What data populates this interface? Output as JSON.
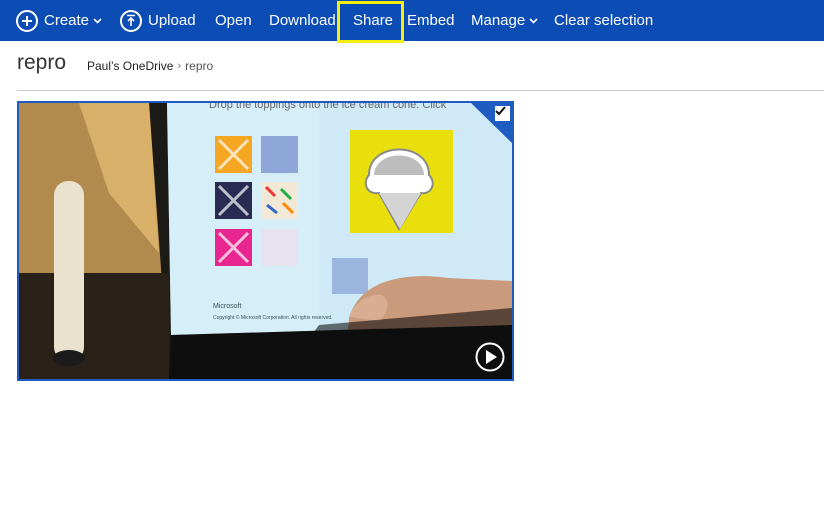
{
  "toolbar": {
    "create": "Create",
    "upload": "Upload",
    "open": "Open",
    "download": "Download",
    "share": "Share",
    "embed": "Embed",
    "manage": "Manage",
    "clear_selection": "Clear selection"
  },
  "folder": {
    "title": "repro",
    "breadcrumb": [
      "Paul’s OneDrive",
      "repro"
    ]
  },
  "video": {
    "screen_caption": "Drop the toppings onto the ice cream cone. Click",
    "screen_brand": "Microsoft",
    "screen_copyright": "Copyright © Microsoft Corporation. All rights reserved.",
    "selected": true
  },
  "colors": {
    "toolbar_bg": "#0b4cb5",
    "highlight": "#f3ee0c",
    "selection_border": "#1f5cc2"
  }
}
